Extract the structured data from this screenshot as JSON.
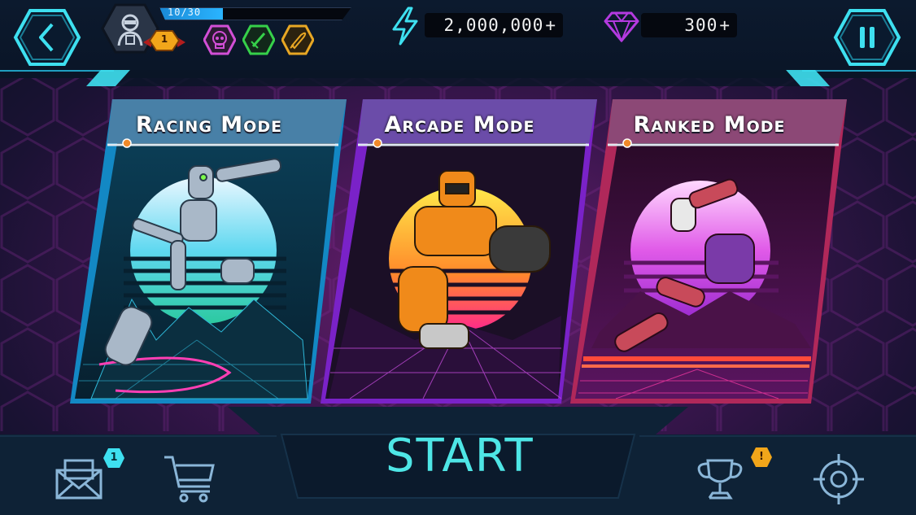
{
  "header": {
    "xp_text": "10/30",
    "xp_progress": 0.33,
    "level": "1",
    "energy_value": "2,000,000",
    "energy_plus": "+",
    "gems_value": "300",
    "gems_plus": "+",
    "icons": [
      "back-icon",
      "avatar-icon",
      "level-badge-icon",
      "skull-icon",
      "sword-icon",
      "rocket-icon",
      "lightning-icon",
      "gem-icon",
      "pause-icon"
    ]
  },
  "modes": [
    {
      "title": "Racing Mode",
      "accent": "#2aa6d8"
    },
    {
      "title": "Arcade Mode",
      "accent": "#8c3ad6"
    },
    {
      "title": "Ranked Mode",
      "accent": "#c23060"
    }
  ],
  "footer": {
    "start_label": "START",
    "mail_count": "1",
    "trophy_alert": "!",
    "icons": [
      "mail-icon",
      "cart-icon",
      "trophy-icon",
      "target-icon"
    ]
  },
  "colors": {
    "neon_cyan": "#3ee0f0",
    "skull": "#d24fd6",
    "sword": "#36d04a",
    "rocket": "#e8a724",
    "gem": "#b43ae0",
    "badge_gold": "#f2a61a"
  }
}
